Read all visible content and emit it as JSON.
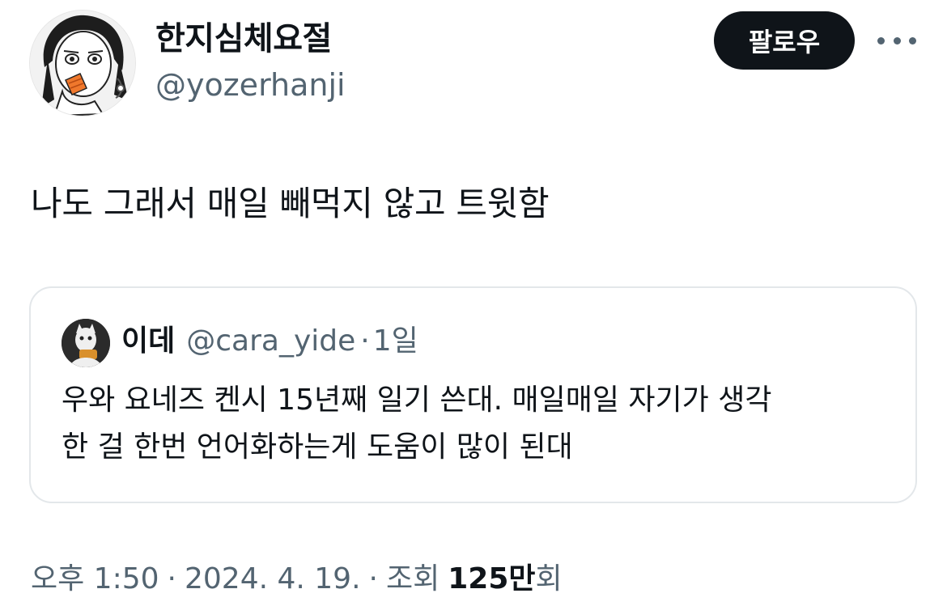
{
  "author": {
    "display_name": "한지심체요절",
    "handle": "@yozerhanji"
  },
  "follow_button": {
    "label": "팔로우"
  },
  "more_icon": "more-horizontal-icon",
  "tweet": {
    "text": "나도 그래서 매일 빼먹지 않고 트윗함"
  },
  "quoted_tweet": {
    "display_name": "이데",
    "handle": "@cara_yide",
    "separator": "·",
    "time": "1일",
    "text_lines": [
      "우와 요네즈 켄시 15년째 일기 쓴대. 매일매일 자기가 생각",
      "한 걸 한번 언어화하는게 도움이 많이 된대"
    ]
  },
  "meta": {
    "time": "오후 1:50",
    "sep1": "·",
    "date": "2024. 4. 19.",
    "sep2": "·",
    "views_label_prefix": "조회",
    "views_count": "125만",
    "views_label_suffix": "회"
  },
  "colors": {
    "text_primary": "#0f1419",
    "text_secondary": "#536471",
    "button_bg": "#0f1419",
    "card_border": "#e3e7ea"
  }
}
